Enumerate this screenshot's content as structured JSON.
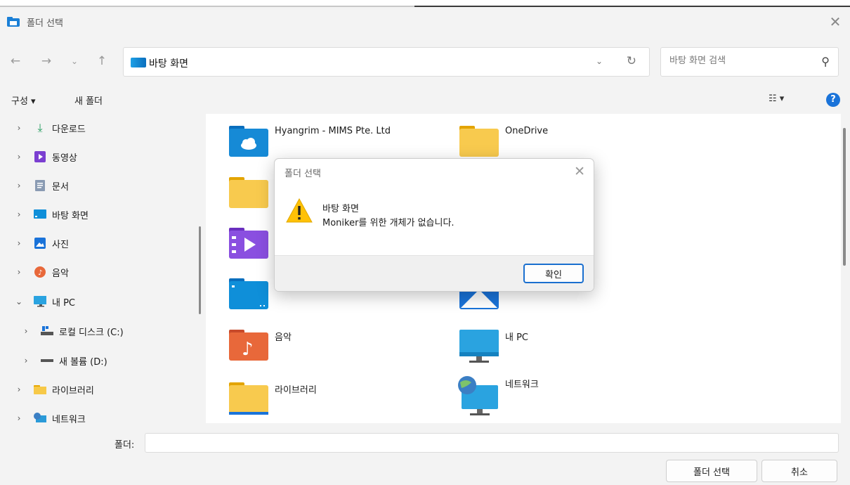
{
  "window": {
    "title": "폴더 선택"
  },
  "address": {
    "location": "바탕 화면"
  },
  "search": {
    "placeholder": "바탕 화면 검색"
  },
  "toolbar": {
    "organize": "구성 ▾",
    "new_folder": "새 폴더"
  },
  "nav_items": [
    {
      "label": "다운로드",
      "icon": "download-icon"
    },
    {
      "label": "동영상",
      "icon": "video-icon"
    },
    {
      "label": "문서",
      "icon": "document-icon"
    },
    {
      "label": "바탕 화면",
      "icon": "desktop-icon"
    },
    {
      "label": "사진",
      "icon": "pictures-icon"
    },
    {
      "label": "음악",
      "icon": "music-icon"
    },
    {
      "label": "내 PC",
      "icon": "pc-icon"
    },
    {
      "label": "로컬 디스크 (C:)",
      "icon": "drive-icon"
    },
    {
      "label": "새 볼륨 (D:)",
      "icon": "drive-icon"
    },
    {
      "label": "라이브러리",
      "icon": "folder-icon"
    },
    {
      "label": "네트워크",
      "icon": "network-icon"
    }
  ],
  "content_items": [
    {
      "label": "Hyangrim - MIMS Pte. Ltd",
      "icon": "cloud-folder-icon"
    },
    {
      "label": "OneDrive",
      "icon": "folder-icon"
    },
    {
      "label": "",
      "icon": "folder-icon"
    },
    {
      "label": "",
      "icon": "video-folder-icon"
    },
    {
      "label": "",
      "icon": "desktop-folder-icon"
    },
    {
      "label": "",
      "icon": "pictures-folder-icon"
    },
    {
      "label": "음악",
      "icon": "music-folder-icon"
    },
    {
      "label": "내 PC",
      "icon": "pc-icon"
    },
    {
      "label": "라이브러리",
      "icon": "folder-icon"
    },
    {
      "label": "네트워크",
      "icon": "network-icon"
    }
  ],
  "bottom": {
    "folder_label": "폴더:",
    "folder_value": "",
    "select_button": "폴더 선택",
    "cancel_button": "취소"
  },
  "dialog": {
    "title": "폴더 선택",
    "line1": "바탕 화면",
    "line2": "Moniker를 위한 개체가 없습니다.",
    "ok_button": "확인"
  }
}
